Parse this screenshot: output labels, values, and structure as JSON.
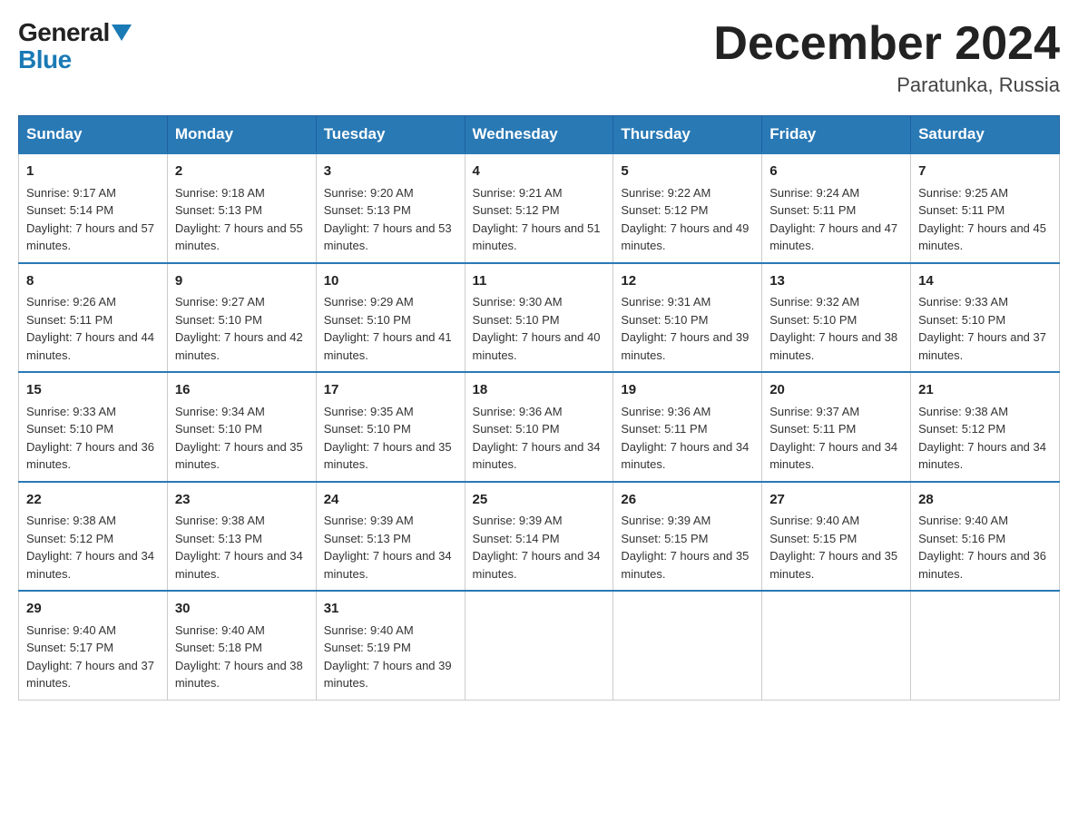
{
  "header": {
    "month_year": "December 2024",
    "location": "Paratunka, Russia",
    "logo_general": "General",
    "logo_blue": "Blue"
  },
  "days_of_week": [
    "Sunday",
    "Monday",
    "Tuesday",
    "Wednesday",
    "Thursday",
    "Friday",
    "Saturday"
  ],
  "weeks": [
    [
      {
        "day": "1",
        "sunrise": "Sunrise: 9:17 AM",
        "sunset": "Sunset: 5:14 PM",
        "daylight": "Daylight: 7 hours and 57 minutes."
      },
      {
        "day": "2",
        "sunrise": "Sunrise: 9:18 AM",
        "sunset": "Sunset: 5:13 PM",
        "daylight": "Daylight: 7 hours and 55 minutes."
      },
      {
        "day": "3",
        "sunrise": "Sunrise: 9:20 AM",
        "sunset": "Sunset: 5:13 PM",
        "daylight": "Daylight: 7 hours and 53 minutes."
      },
      {
        "day": "4",
        "sunrise": "Sunrise: 9:21 AM",
        "sunset": "Sunset: 5:12 PM",
        "daylight": "Daylight: 7 hours and 51 minutes."
      },
      {
        "day": "5",
        "sunrise": "Sunrise: 9:22 AM",
        "sunset": "Sunset: 5:12 PM",
        "daylight": "Daylight: 7 hours and 49 minutes."
      },
      {
        "day": "6",
        "sunrise": "Sunrise: 9:24 AM",
        "sunset": "Sunset: 5:11 PM",
        "daylight": "Daylight: 7 hours and 47 minutes."
      },
      {
        "day": "7",
        "sunrise": "Sunrise: 9:25 AM",
        "sunset": "Sunset: 5:11 PM",
        "daylight": "Daylight: 7 hours and 45 minutes."
      }
    ],
    [
      {
        "day": "8",
        "sunrise": "Sunrise: 9:26 AM",
        "sunset": "Sunset: 5:11 PM",
        "daylight": "Daylight: 7 hours and 44 minutes."
      },
      {
        "day": "9",
        "sunrise": "Sunrise: 9:27 AM",
        "sunset": "Sunset: 5:10 PM",
        "daylight": "Daylight: 7 hours and 42 minutes."
      },
      {
        "day": "10",
        "sunrise": "Sunrise: 9:29 AM",
        "sunset": "Sunset: 5:10 PM",
        "daylight": "Daylight: 7 hours and 41 minutes."
      },
      {
        "day": "11",
        "sunrise": "Sunrise: 9:30 AM",
        "sunset": "Sunset: 5:10 PM",
        "daylight": "Daylight: 7 hours and 40 minutes."
      },
      {
        "day": "12",
        "sunrise": "Sunrise: 9:31 AM",
        "sunset": "Sunset: 5:10 PM",
        "daylight": "Daylight: 7 hours and 39 minutes."
      },
      {
        "day": "13",
        "sunrise": "Sunrise: 9:32 AM",
        "sunset": "Sunset: 5:10 PM",
        "daylight": "Daylight: 7 hours and 38 minutes."
      },
      {
        "day": "14",
        "sunrise": "Sunrise: 9:33 AM",
        "sunset": "Sunset: 5:10 PM",
        "daylight": "Daylight: 7 hours and 37 minutes."
      }
    ],
    [
      {
        "day": "15",
        "sunrise": "Sunrise: 9:33 AM",
        "sunset": "Sunset: 5:10 PM",
        "daylight": "Daylight: 7 hours and 36 minutes."
      },
      {
        "day": "16",
        "sunrise": "Sunrise: 9:34 AM",
        "sunset": "Sunset: 5:10 PM",
        "daylight": "Daylight: 7 hours and 35 minutes."
      },
      {
        "day": "17",
        "sunrise": "Sunrise: 9:35 AM",
        "sunset": "Sunset: 5:10 PM",
        "daylight": "Daylight: 7 hours and 35 minutes."
      },
      {
        "day": "18",
        "sunrise": "Sunrise: 9:36 AM",
        "sunset": "Sunset: 5:10 PM",
        "daylight": "Daylight: 7 hours and 34 minutes."
      },
      {
        "day": "19",
        "sunrise": "Sunrise: 9:36 AM",
        "sunset": "Sunset: 5:11 PM",
        "daylight": "Daylight: 7 hours and 34 minutes."
      },
      {
        "day": "20",
        "sunrise": "Sunrise: 9:37 AM",
        "sunset": "Sunset: 5:11 PM",
        "daylight": "Daylight: 7 hours and 34 minutes."
      },
      {
        "day": "21",
        "sunrise": "Sunrise: 9:38 AM",
        "sunset": "Sunset: 5:12 PM",
        "daylight": "Daylight: 7 hours and 34 minutes."
      }
    ],
    [
      {
        "day": "22",
        "sunrise": "Sunrise: 9:38 AM",
        "sunset": "Sunset: 5:12 PM",
        "daylight": "Daylight: 7 hours and 34 minutes."
      },
      {
        "day": "23",
        "sunrise": "Sunrise: 9:38 AM",
        "sunset": "Sunset: 5:13 PM",
        "daylight": "Daylight: 7 hours and 34 minutes."
      },
      {
        "day": "24",
        "sunrise": "Sunrise: 9:39 AM",
        "sunset": "Sunset: 5:13 PM",
        "daylight": "Daylight: 7 hours and 34 minutes."
      },
      {
        "day": "25",
        "sunrise": "Sunrise: 9:39 AM",
        "sunset": "Sunset: 5:14 PM",
        "daylight": "Daylight: 7 hours and 34 minutes."
      },
      {
        "day": "26",
        "sunrise": "Sunrise: 9:39 AM",
        "sunset": "Sunset: 5:15 PM",
        "daylight": "Daylight: 7 hours and 35 minutes."
      },
      {
        "day": "27",
        "sunrise": "Sunrise: 9:40 AM",
        "sunset": "Sunset: 5:15 PM",
        "daylight": "Daylight: 7 hours and 35 minutes."
      },
      {
        "day": "28",
        "sunrise": "Sunrise: 9:40 AM",
        "sunset": "Sunset: 5:16 PM",
        "daylight": "Daylight: 7 hours and 36 minutes."
      }
    ],
    [
      {
        "day": "29",
        "sunrise": "Sunrise: 9:40 AM",
        "sunset": "Sunset: 5:17 PM",
        "daylight": "Daylight: 7 hours and 37 minutes."
      },
      {
        "day": "30",
        "sunrise": "Sunrise: 9:40 AM",
        "sunset": "Sunset: 5:18 PM",
        "daylight": "Daylight: 7 hours and 38 minutes."
      },
      {
        "day": "31",
        "sunrise": "Sunrise: 9:40 AM",
        "sunset": "Sunset: 5:19 PM",
        "daylight": "Daylight: 7 hours and 39 minutes."
      },
      null,
      null,
      null,
      null
    ]
  ]
}
